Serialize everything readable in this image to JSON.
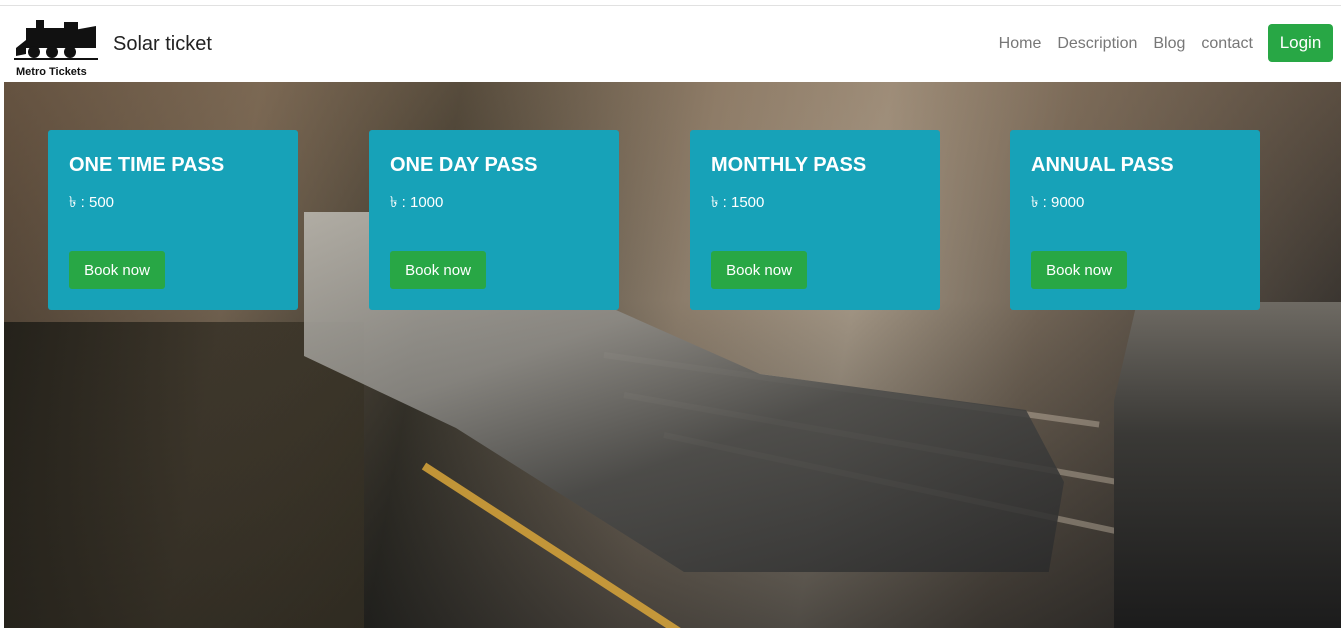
{
  "header": {
    "logo_text": "Metro Tickets",
    "brand": "Solar ticket",
    "nav": [
      "Home",
      "Description",
      "Blog",
      "contact"
    ],
    "login_label": "Login"
  },
  "passes": [
    {
      "title": "ONE TIME PASS",
      "price": "৳ : 500",
      "button": "Book now"
    },
    {
      "title": "ONE DAY PASS",
      "price": "৳ : 1000",
      "button": "Book now"
    },
    {
      "title": "MONTHLY PASS",
      "price": "৳ : 1500",
      "button": "Book now"
    },
    {
      "title": "ANNUAL PASS",
      "price": "৳ : 9000",
      "button": "Book now"
    }
  ],
  "colors": {
    "card": "#17a2b8",
    "button": "#28a745"
  }
}
